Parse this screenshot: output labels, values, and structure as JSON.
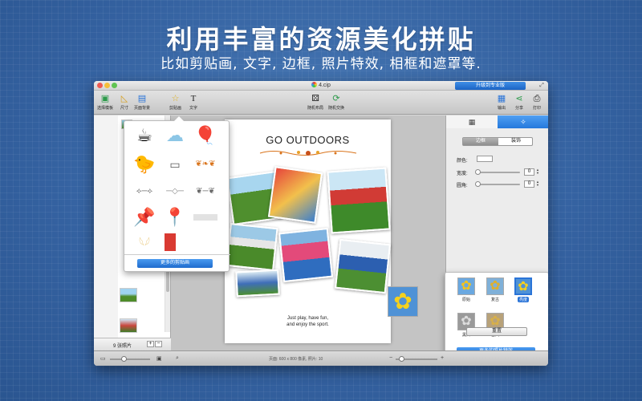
{
  "promo": {
    "headline": "利用丰富的资源美化拼贴",
    "subheadline": "比如剪贴画, 文字, 边框, 照片特效, 相框和遮罩等."
  },
  "window": {
    "title": "4.cip",
    "upgrade_label": "升级到专业版"
  },
  "toolbar": {
    "items": [
      {
        "label": "选择模板",
        "icon": "template-icon"
      },
      {
        "label": "尺寸",
        "icon": "ruler-icon"
      },
      {
        "label": "页面背景",
        "icon": "paint-roller-icon"
      },
      {
        "label": "剪贴画",
        "icon": "star-icon"
      },
      {
        "label": "文字",
        "icon": "text-icon"
      },
      {
        "label": "随机布局",
        "icon": "dice-icon"
      },
      {
        "label": "随机交换",
        "icon": "shuffle-icon"
      },
      {
        "label": "输出",
        "icon": "export-icon"
      },
      {
        "label": "分享",
        "icon": "share-icon"
      },
      {
        "label": "打印",
        "icon": "printer-icon"
      }
    ]
  },
  "left_panel": {
    "photo_count": "9 张照片",
    "add": "+",
    "remove": "−"
  },
  "page": {
    "title": "GO OUTDOORS",
    "caption_line1": "Just play, have fun,",
    "caption_line2": "and enjoy the sport."
  },
  "clipart": {
    "more_label": "更多的剪贴画",
    "items": [
      "coffee-cup-clipart",
      "cloud-clipart",
      "balloons-clipart",
      "rubber-duck-clipart",
      "frame-ornament-clipart",
      "border-flourish-clipart",
      "divider-flourish-1",
      "divider-flourish-2",
      "divider-flourish-3",
      "blue-pushpin-clipart",
      "yellow-pushpin-clipart",
      "tape-clipart",
      "wings-clipart",
      "red-tag-clipart"
    ]
  },
  "inspector": {
    "seg_border": "边框",
    "seg_decor": "装饰",
    "color_label": "颜色:",
    "width_label": "宽度:",
    "radius_label": "圆角:",
    "width_value": "0",
    "radius_value": "0",
    "reset_label": "重置"
  },
  "effects": {
    "items": [
      {
        "name": "原始"
      },
      {
        "name": "复古"
      },
      {
        "name": "亮度"
      },
      {
        "name": "黑白"
      },
      {
        "name": "古风"
      }
    ],
    "more_label": "更多的照片特效"
  },
  "statusbar": {
    "text": "页面: 600 x 800 像素, 照片: 10"
  },
  "colors": {
    "accent": "#2a74d8",
    "background": "#3d6ea8"
  }
}
